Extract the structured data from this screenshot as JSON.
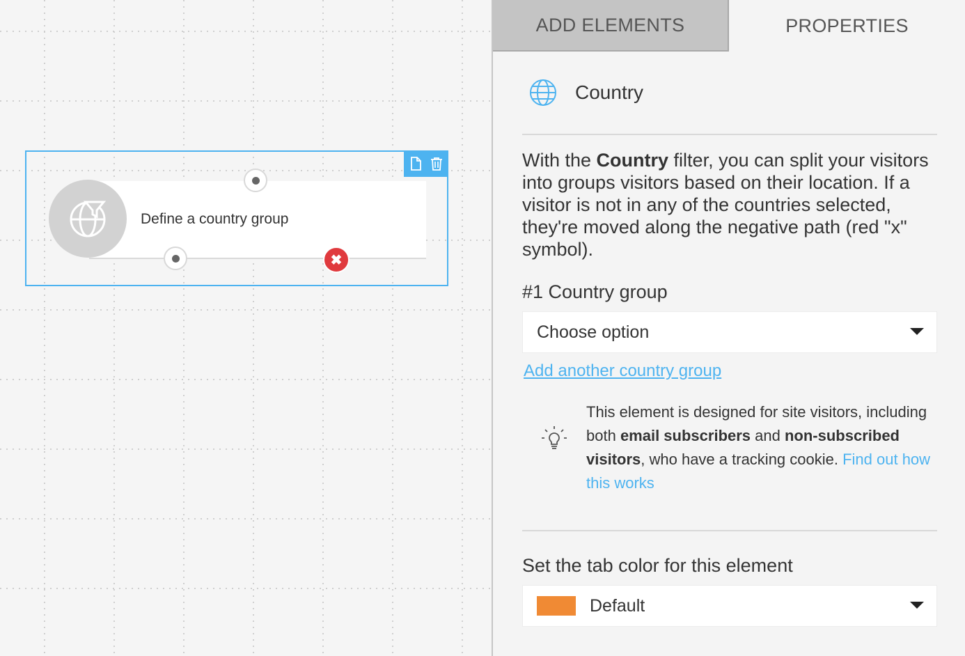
{
  "canvas": {
    "node": {
      "label": "Define a country group",
      "icon": "globe-filter-icon",
      "toolbar": {
        "copy_icon": "document-icon",
        "delete_icon": "trash-icon"
      },
      "negative_symbol": "✖"
    }
  },
  "tabs": [
    {
      "label": "ADD ELEMENTS",
      "active": false
    },
    {
      "label": "PROPERTIES",
      "active": true
    }
  ],
  "properties": {
    "element_name": "Country",
    "element_icon": "globe-icon",
    "description": {
      "pre": "With the ",
      "bold": "Country",
      "post": " filter, you can split your visitors into groups visitors based on their location. If a visitor is not in any of the countries selected, they're moved along the negative path (red \"x\" symbol)."
    },
    "group_label": "#1 Country group",
    "group_select": "Choose option",
    "add_group_link": "Add another country group",
    "tip": {
      "icon": "lightbulb-icon",
      "t1": "This element is designed for site visitors, including both ",
      "b1": "email subscribers",
      "t2": " and ",
      "b2": "non-subscribed visitors",
      "t3": ", who have a tracking cookie. ",
      "link": "Find out how this works"
    },
    "tab_color_label": "Set the tab color for this element",
    "tab_color_select": "Default",
    "tab_color_hex": "#f08a34"
  },
  "colors": {
    "accent": "#4db3f0",
    "negative": "#e03a3e"
  }
}
